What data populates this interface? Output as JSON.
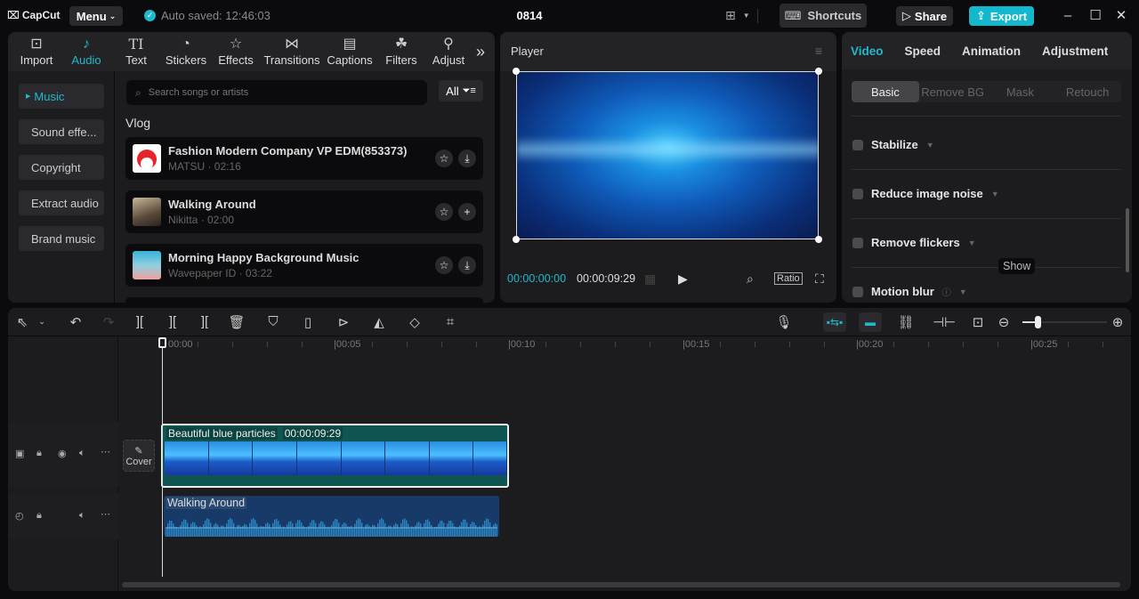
{
  "titlebar": {
    "app_name": "CapCut",
    "menu_label": "Menu",
    "autosave_text": "Auto saved: 12:46:03",
    "project_title": "0814",
    "shortcuts_label": "Shortcuts",
    "share_label": "Share",
    "export_label": "Export",
    "accent_color": "#14b8cc"
  },
  "media_toolbar": {
    "tools": [
      {
        "label": "Import",
        "icon": "import-icon"
      },
      {
        "label": "Audio",
        "icon": "music-note-icon",
        "active": true
      },
      {
        "label": "Text",
        "icon": "text-icon"
      },
      {
        "label": "Stickers",
        "icon": "sticker-icon"
      },
      {
        "label": "Effects",
        "icon": "effects-star-icon"
      },
      {
        "label": "Transitions",
        "icon": "transition-icon"
      },
      {
        "label": "Captions",
        "icon": "captions-icon"
      },
      {
        "label": "Filters",
        "icon": "filters-icon"
      },
      {
        "label": "Adjust",
        "icon": "adjust-sliders-icon"
      }
    ]
  },
  "audio_nav": {
    "items": [
      {
        "label": "Music",
        "active": true
      },
      {
        "label": "Sound effe..."
      },
      {
        "label": "Copyright"
      },
      {
        "label": "Extract audio"
      },
      {
        "label": "Brand music"
      }
    ]
  },
  "audio_library": {
    "search_placeholder": "Search songs or artists",
    "filter_label": "All",
    "category": "Vlog",
    "songs": [
      {
        "title": "Fashion Modern Company VP EDM(853373)",
        "subtitle": "MATSU · 02:16",
        "action": "download"
      },
      {
        "title": "Walking Around",
        "subtitle": "Nikitta · 02:00",
        "action": "add"
      },
      {
        "title": "Morning Happy Background Music",
        "subtitle": "Wavepaper ID · 03:22",
        "action": "download"
      }
    ]
  },
  "player": {
    "title": "Player",
    "current_time": "00:00:00:00",
    "total_time": "00:00:09:29",
    "ratio_label": "Ratio"
  },
  "properties": {
    "tabs": [
      {
        "label": "Video",
        "active": true
      },
      {
        "label": "Speed"
      },
      {
        "label": "Animation"
      },
      {
        "label": "Adjustment"
      }
    ],
    "subtabs": [
      {
        "label": "Basic",
        "active": true
      },
      {
        "label": "Remove BG"
      },
      {
        "label": "Mask"
      },
      {
        "label": "Retouch"
      }
    ],
    "options": [
      {
        "label": "Stabilize",
        "checked": false
      },
      {
        "label": "Reduce image noise",
        "checked": false
      },
      {
        "label": "Remove flickers",
        "checked": false
      },
      {
        "label": "Motion blur",
        "checked": false
      }
    ],
    "tooltip": "Show"
  },
  "timeline": {
    "ruler_labels": [
      "00:00",
      "|00:05",
      "|00:10",
      "|00:15",
      "|00:20",
      "|00:25"
    ],
    "zoom_level": 0.18,
    "cover_label": "Cover",
    "video_clip": {
      "name": "Beautiful blue particles",
      "duration": "00:00:09:29"
    },
    "audio_clip": {
      "name": "Walking Around"
    }
  }
}
